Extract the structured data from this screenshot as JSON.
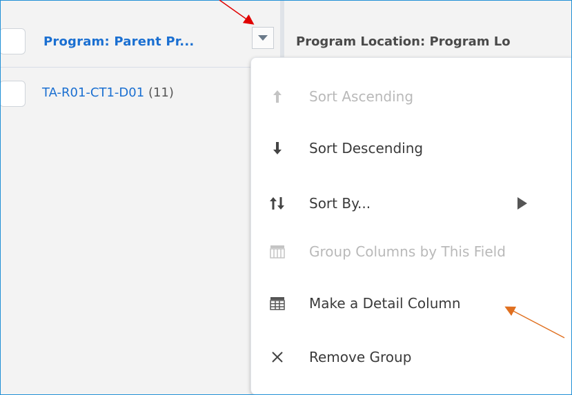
{
  "header": {
    "column1_label": "Program: Parent Pr...",
    "column2_label": "Program Location: Program Lo"
  },
  "row": {
    "link_text": "TA-R01-CT1-D01",
    "count_text": "(11)"
  },
  "menu": {
    "items": [
      {
        "label": "Sort Ascending",
        "icon": "arrow-up-icon",
        "enabled": false
      },
      {
        "label": "Sort Descending",
        "icon": "arrow-down-icon",
        "enabled": true
      },
      {
        "label": "Sort By...",
        "icon": "sort-up-down-icon",
        "enabled": true,
        "has_submenu": true
      },
      {
        "label": "Group Columns by This Field",
        "icon": "group-columns-icon",
        "enabled": false
      },
      {
        "label": "Make a Detail Column",
        "icon": "detail-column-icon",
        "enabled": true
      },
      {
        "label": "Remove Group",
        "icon": "close-icon",
        "enabled": true
      }
    ]
  },
  "annotation_colors": {
    "red_arrow": "#e00000",
    "orange_arrow": "#e07020"
  }
}
